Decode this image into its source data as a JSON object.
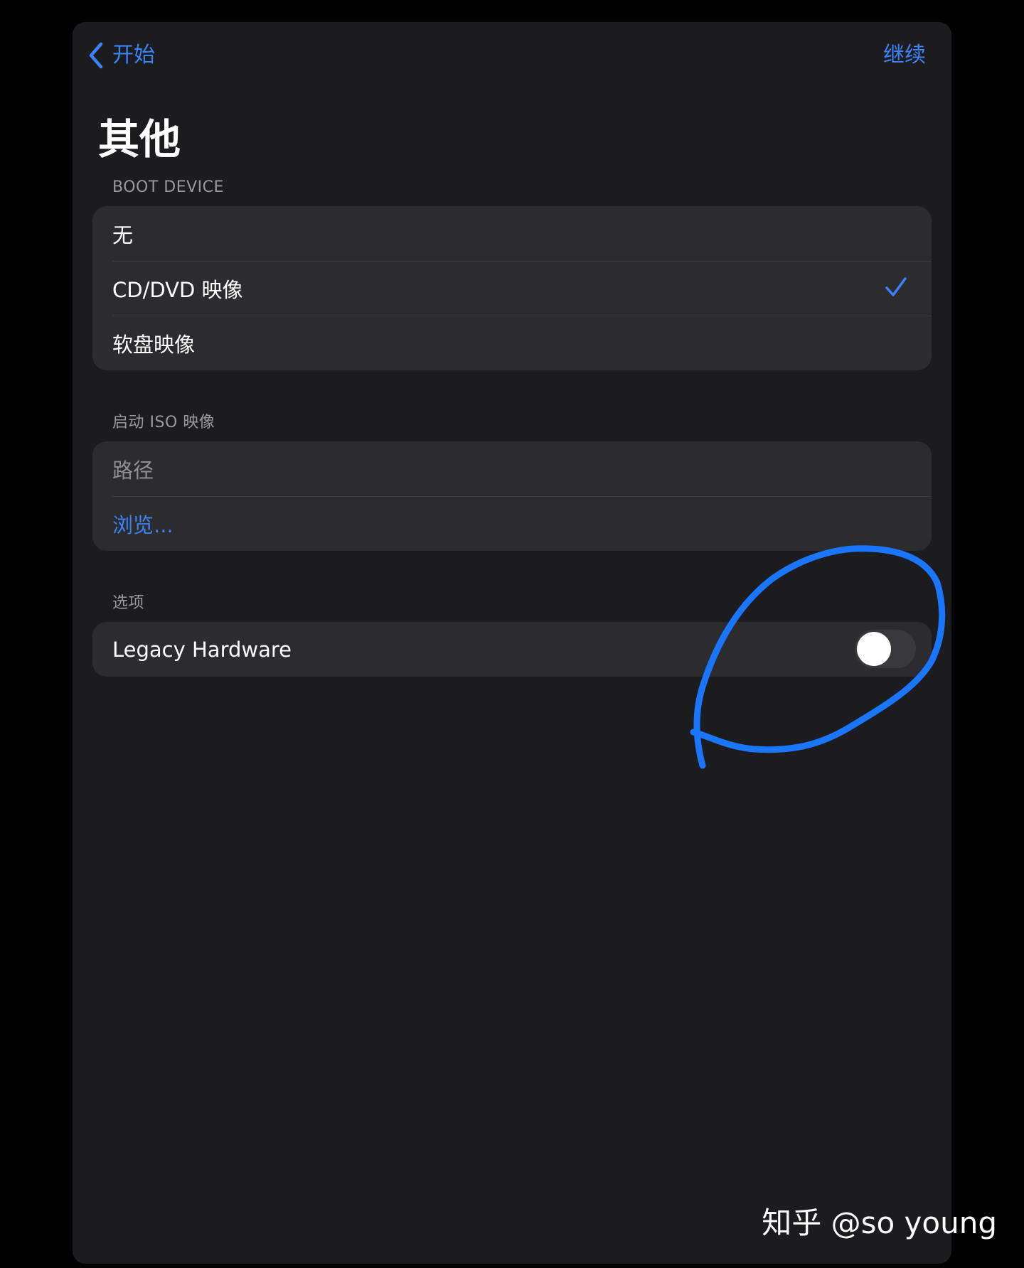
{
  "nav": {
    "back_label": "开始",
    "continue_label": "继续",
    "accent_color": "#3a82f7"
  },
  "page": {
    "title": "其他"
  },
  "boot_device": {
    "header": "BOOT DEVICE",
    "options": [
      {
        "label": "无",
        "selected": false
      },
      {
        "label": "CD/DVD 映像",
        "selected": true
      },
      {
        "label": "软盘映像",
        "selected": false
      }
    ],
    "checkmark_icon": "checkmark-icon"
  },
  "boot_iso": {
    "header": "启动 ISO 映像",
    "path_placeholder": "路径",
    "browse_label": "浏览..."
  },
  "options": {
    "header": "选项",
    "legacy_hardware_label": "Legacy Hardware",
    "legacy_hardware_enabled": false
  },
  "annotation": {
    "stroke_color": "#1a75ff",
    "description_icon": "hand-drawn-circle"
  },
  "watermark": {
    "text": "知乎 @so young"
  }
}
